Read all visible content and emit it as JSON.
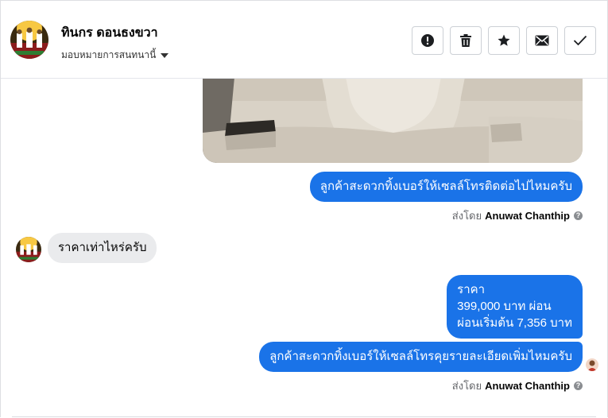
{
  "header": {
    "contact_name": "ทินกร ดอนธงขวา",
    "assign_label": "มอบหมายการสนทนานี้",
    "avatar_icon": "group-photo-avatar",
    "actions": [
      {
        "icon": "exclamation-circle-icon",
        "label": "Mark as spam"
      },
      {
        "icon": "trash-icon",
        "label": "Delete"
      },
      {
        "icon": "star-icon",
        "label": "Star"
      },
      {
        "icon": "envelope-icon",
        "label": "Mark as unread"
      },
      {
        "icon": "checkmark-icon",
        "label": "Mark as done"
      }
    ]
  },
  "conversation": {
    "photo_icon": "car-interior-photo",
    "out_msg_1": "ลูกค้าสะดวกทิ้งเบอร์ให้เซลล์โทรติดต่อไปไหมครับ",
    "sent_by_prefix_1": "ส่งโดย",
    "sent_by_name_1": "Anuwat Chanthip",
    "in_msg_1": "ราคาเท่าไหร่ครับ",
    "price_line_1": "ราคา",
    "price_line_2": "399,000 บาท ผ่อน",
    "price_line_3": "ผ่อนเริ่มต้น 7,356 บาท",
    "out_msg_2": "ลูกค้าสะดวกทิ้งเบอร์ให้เซลล์โทรคุยรายละเอียดเพิ่มไหมครับ",
    "sent_by_prefix_2": "ส่งโดย",
    "sent_by_name_2": "Anuwat Chanthip",
    "help_glyph": "?"
  },
  "colors": {
    "outgoing_bubble": "#1a73e8",
    "incoming_bubble": "#eaebed",
    "muted_text": "#65676b"
  }
}
